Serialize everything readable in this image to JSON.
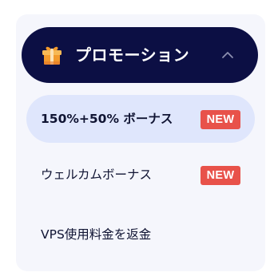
{
  "menu": {
    "title": "プロモーション",
    "title_icon": "gift-icon",
    "toggle_icon": "chevron-up-icon",
    "expanded": true,
    "items": [
      {
        "label": "150%+50% ボーナス",
        "badge": "NEW",
        "active": true
      },
      {
        "label": "ウェルカムボーナス",
        "badge": "NEW",
        "active": false
      },
      {
        "label": "VPS使用料金を返金",
        "active": false
      }
    ]
  },
  "colors": {
    "header_bg": "#0c0f44",
    "panel_bg": "#f5f6fc",
    "active_item_bg": "#dfe6fc",
    "badge_bg": "#e8524a",
    "text": "#101433"
  }
}
